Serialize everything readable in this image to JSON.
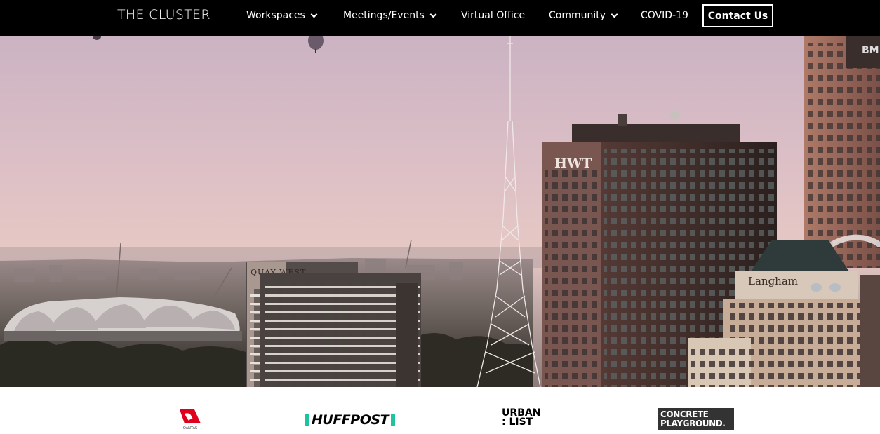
{
  "brand": "THE CLUSTER",
  "nav": {
    "workspaces": "Workspaces",
    "meetings": "Meetings/Events",
    "virtual_office": "Virtual Office",
    "community": "Community",
    "covid": "COVID-19",
    "contact": "Contact Us"
  },
  "hero": {
    "alt": "Melbourne city skyline at sunset with hot air balloons"
  },
  "logos": {
    "qantas": "QANTAS",
    "huffpost": "HUFFPOST",
    "urban_line1": "URBAN",
    "urban_line2": ": LIST",
    "concrete_line1": "CONCRETE",
    "concrete_line2": "PLAYGROUND."
  },
  "colors": {
    "nav_bg": "#000000",
    "huffpost_green": "#1ec3a0",
    "qantas_red": "#e0001b"
  }
}
